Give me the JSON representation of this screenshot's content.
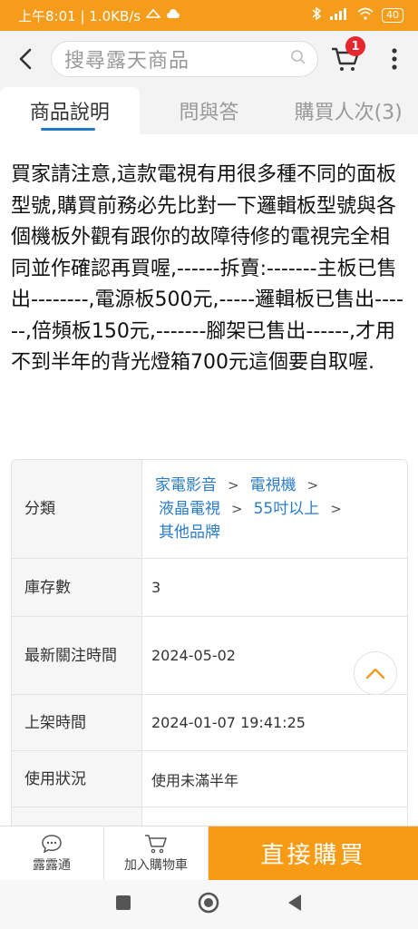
{
  "status": {
    "time_speed": "上午8:01 | 1.0KB/s",
    "battery": "40"
  },
  "search": {
    "placeholder": "搜尋露天商品",
    "cart_count": "1"
  },
  "tabs": [
    {
      "label": "商品說明"
    },
    {
      "label": "問與答"
    },
    {
      "label": "購買人次(3)"
    }
  ],
  "description": "買家請注意,這款電視有用很多種不同的面板型號,購買前務必先比對一下邏輯板型號與各個機板外觀有跟你的故障待修的電視完全相同並作確認再買喔,------拆賣:-------主板已售出--------,電源板500元,-----邏輯板已售出------,倍頻板150元,-------腳架已售出------,才用不到半年的背光燈箱700元這個要自取喔.",
  "specs": {
    "category_label": "分類",
    "category_path": [
      "家電影音",
      "電視機",
      "液晶電視",
      "55吋以上",
      "其他品牌"
    ],
    "stock_label": "庫存數",
    "stock_value": "3",
    "last_watch_label": "最新關注時間",
    "last_watch_value": "2024-05-02",
    "listed_label": "上架時間",
    "listed_value": "2024-01-07 19:41:25",
    "condition_label": "使用狀況",
    "condition_value": "使用未滿半年"
  },
  "bottom": {
    "chat_label": "露露通",
    "add_cart_label": "加入購物車",
    "buy_label": "直接購買"
  },
  "colors": {
    "accent": "#f79b15",
    "link": "#2a7cc7",
    "badge": "#e8262d"
  }
}
